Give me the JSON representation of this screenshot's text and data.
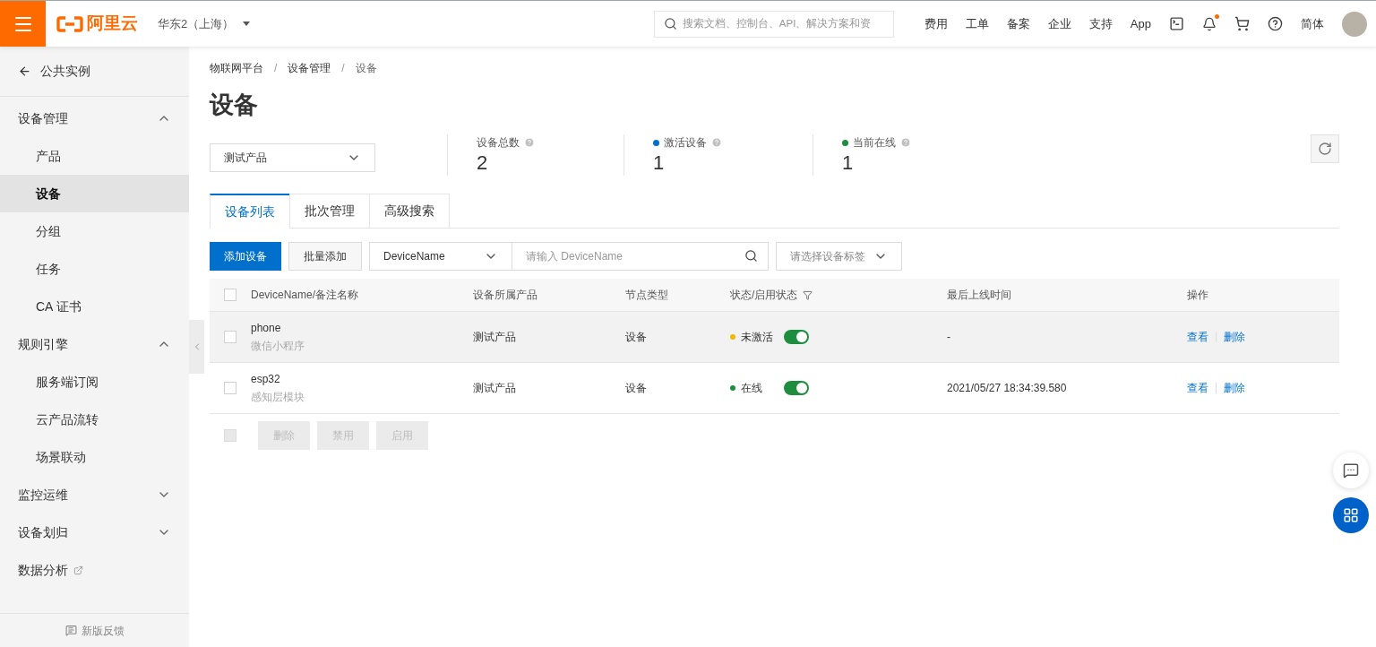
{
  "header": {
    "logo_text": "阿里云",
    "region": "华东2（上海）",
    "search_placeholder": "搜索文档、控制台、API、解决方案和资",
    "nav": [
      "费用",
      "工单",
      "备案",
      "企业",
      "支持",
      "App"
    ],
    "notification_dot": true,
    "language": "简体"
  },
  "sidebar": {
    "back": "公共实例",
    "items": [
      {
        "kind": "group",
        "label": "设备管理",
        "expanded": true,
        "children": [
          {
            "label": "产品",
            "selected": false
          },
          {
            "label": "设备",
            "selected": true
          },
          {
            "label": "分组",
            "selected": false
          },
          {
            "label": "任务",
            "selected": false
          },
          {
            "label": "CA 证书",
            "selected": false
          }
        ]
      },
      {
        "kind": "group",
        "label": "规则引擎",
        "expanded": true,
        "children": [
          {
            "label": "服务端订阅",
            "selected": false
          },
          {
            "label": "云产品流转",
            "selected": false
          },
          {
            "label": "场景联动",
            "selected": false
          }
        ]
      },
      {
        "kind": "group",
        "label": "监控运维",
        "expanded": false
      },
      {
        "kind": "group",
        "label": "设备划归",
        "expanded": false
      },
      {
        "kind": "link",
        "label": "数据分析"
      }
    ],
    "feedback": "新版反馈"
  },
  "breadcrumb": {
    "items": [
      "物联网平台",
      "设备管理",
      "设备"
    ],
    "separators": [
      "/",
      "/"
    ]
  },
  "title": "设备",
  "product_select": "测试产品",
  "stats": [
    {
      "label": "设备总数",
      "value": "2"
    },
    {
      "label": "激活设备",
      "value": "1",
      "color": "#0070cc"
    },
    {
      "label": "当前在线",
      "value": "1",
      "color": "#1e8e3e"
    }
  ],
  "tabs": [
    {
      "label": "设备列表",
      "selected": true
    },
    {
      "label": "批次管理",
      "selected": false
    },
    {
      "label": "高级搜索",
      "selected": false
    }
  ],
  "toolbar": {
    "primary": "添加设备",
    "secondary": "批量添加",
    "filter_select": "DeviceName",
    "search_placeholder": "请输入 DeviceName",
    "tag_placeholder": "请选择设备标签"
  },
  "table": {
    "columns": [
      "DeviceName/备注名称",
      "设备所属产品",
      "节点类型",
      "状态/启用状态",
      "最后上线时间",
      "操作"
    ],
    "rows": [
      {
        "name": "phone",
        "note": "微信小程序",
        "product": "测试产品",
        "node_type": "设备",
        "status": "未激活",
        "color": "#f5b400",
        "enabled": true,
        "checked": false,
        "highlighted": true,
        "last_online": "-",
        "actions": [
          "查看",
          "删除"
        ]
      },
      {
        "name": "esp32",
        "note": "感知层模块",
        "product": "测试产品",
        "node_type": "设备",
        "status": "在线",
        "color": "#1e8e3e",
        "enabled": true,
        "checked": false,
        "highlighted": false,
        "last_online": "2021/05/27 18:34:39.580",
        "actions": [
          "查看",
          "删除"
        ]
      }
    ],
    "footer_buttons": [
      {
        "label": "删除",
        "disabled": true
      },
      {
        "label": "禁用",
        "disabled": true
      },
      {
        "label": "启用",
        "disabled": true
      }
    ],
    "select_all": {
      "checked": false,
      "disabled": true
    }
  }
}
